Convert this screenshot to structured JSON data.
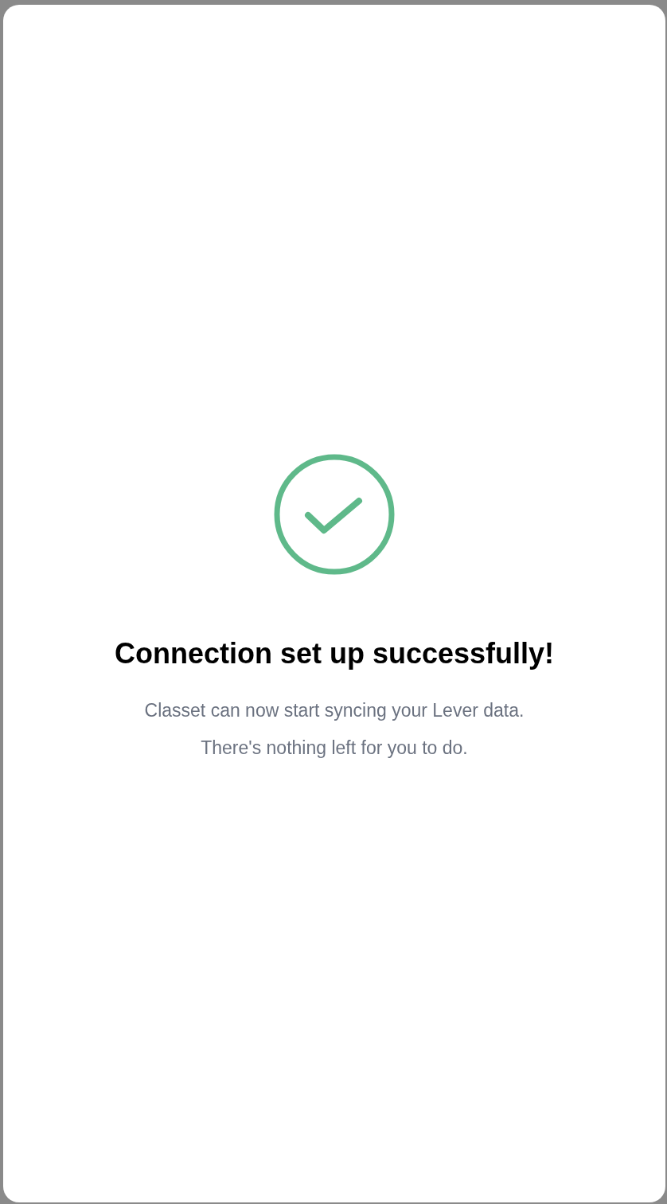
{
  "status": {
    "kind": "success",
    "title": "Connection set up successfully!",
    "lines": [
      "Classet can now start syncing your Lever data.",
      "There's nothing left for you to do."
    ]
  }
}
